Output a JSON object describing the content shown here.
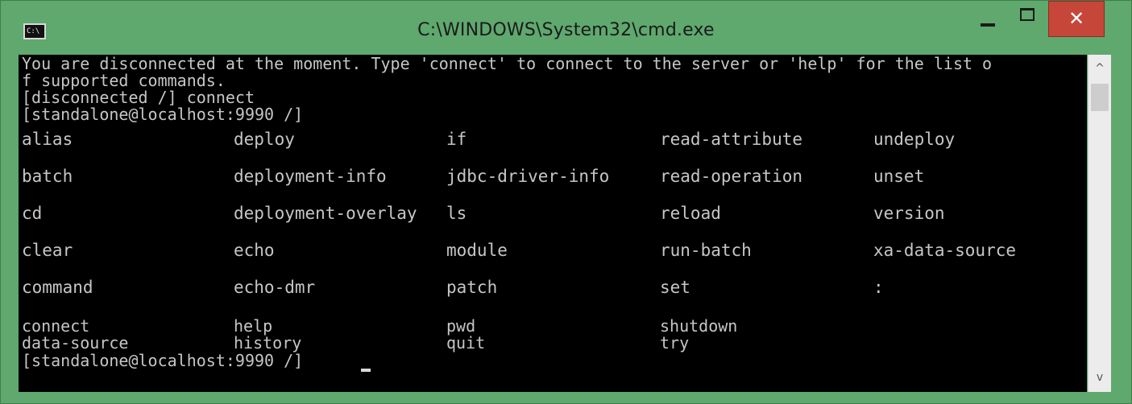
{
  "window": {
    "title": "C:\\WINDOWS\\System32\\cmd.exe",
    "icon": "cmd-icon",
    "icon_text": "C:\\",
    "controls": {
      "minimize_icon": "minimize-icon",
      "maximize_icon": "maximize-icon",
      "close_icon": "close-icon",
      "close_glyph": "✕"
    },
    "colors": {
      "frame": "#5fa86e",
      "close": "#c7463a",
      "console_bg": "#000000",
      "console_fg": "#c6c6c6"
    }
  },
  "console": {
    "lines": [
      "You are disconnected at the moment. Type 'connect' to connect to the server or 'help' for the list o",
      "f supported commands.",
      "[disconnected /] connect",
      "[standalone@localhost:9990 /]"
    ],
    "commands": [
      [
        "alias",
        "deploy",
        "if",
        "read-attribute",
        "undeploy"
      ],
      [
        "batch",
        "deployment-info",
        "jdbc-driver-info",
        "read-operation",
        "unset"
      ],
      [
        "cd",
        "deployment-overlay",
        "ls",
        "reload",
        "version"
      ],
      [
        "clear",
        "echo",
        "module",
        "run-batch",
        "xa-data-source"
      ],
      [
        "command",
        "echo-dmr",
        "patch",
        "set",
        ":"
      ],
      [
        "connect",
        "help",
        "pwd",
        "shutdown",
        ""
      ],
      [
        "data-source",
        "history",
        "quit",
        "try",
        ""
      ]
    ],
    "prompt": "[standalone@localhost:9990 /]"
  },
  "scrollbar": {
    "up_glyph": "^",
    "down_glyph": "v"
  }
}
